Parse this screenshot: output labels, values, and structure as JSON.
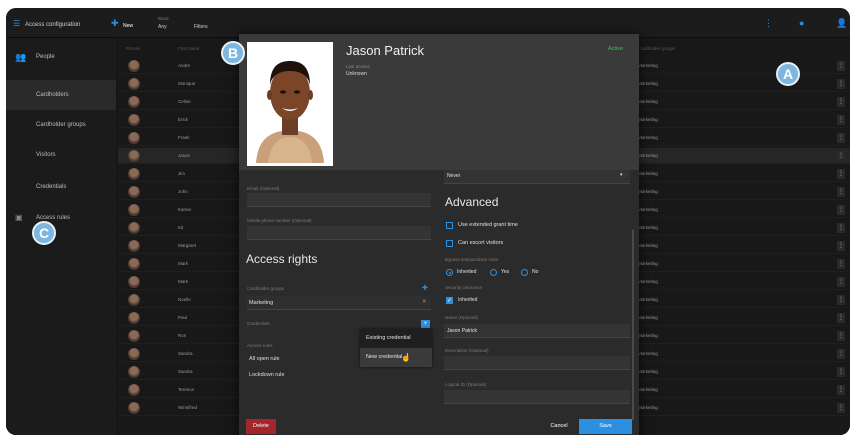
{
  "topbar": {
    "title": "Access configuration",
    "new_label": "New",
    "basic_label": "Basic",
    "any_label": "Any",
    "filters_label": "Filters"
  },
  "nav": {
    "section": "People",
    "items": [
      "Cardholders",
      "Cardholder groups",
      "Visitors",
      "Credentials"
    ],
    "access_rules": "Access rules"
  },
  "table": {
    "headers": [
      "Picture",
      "First name",
      "Cardholder groups"
    ],
    "rows": [
      {
        "first": "Andre",
        "group": "Marketing"
      },
      {
        "first": "Monique",
        "group": "Marketing"
      },
      {
        "first": "Celine",
        "group": "Marketing"
      },
      {
        "first": "Erick",
        "group": "Marketing"
      },
      {
        "first": "Frank",
        "group": "Marketing"
      },
      {
        "first": "Jason",
        "group": "Marketing"
      },
      {
        "first": "Jim",
        "group": "Marketing"
      },
      {
        "first": "John",
        "group": "Marketing"
      },
      {
        "first": "Karine",
        "group": "Marketing"
      },
      {
        "first": "Kit",
        "group": "Marketing"
      },
      {
        "first": "Margaret",
        "group": "Marketing"
      },
      {
        "first": "Mark",
        "group": "Marketing"
      },
      {
        "first": "Mark",
        "group": "Marketing"
      },
      {
        "first": "Noelle",
        "group": "Marketing"
      },
      {
        "first": "Paul",
        "group": "Marketing"
      },
      {
        "first": "Ron",
        "group": "Marketing"
      },
      {
        "first": "Sandra",
        "group": "Marketing"
      },
      {
        "first": "Sandra",
        "group": "Marketing"
      },
      {
        "first": "Terence",
        "group": "Marketing"
      },
      {
        "first": "Winnifred",
        "group": "Marketing"
      }
    ]
  },
  "modal": {
    "name": "Jason Patrick",
    "status": "Active",
    "last_access_label": "Last access",
    "last_access_value": "Unknown",
    "email_label": "Email (Optional)",
    "phone_label": "Mobile phone number (Optional)",
    "access_rights_heading": "Access rights",
    "cardholder_groups_label": "Cardholder groups",
    "cardholder_group_value": "Marketing",
    "credentials_label": "Credentials",
    "access_rules_label": "Access rules",
    "access_rules": [
      "All open rule",
      "Lockdown rule"
    ],
    "expiry_value": "Never",
    "advanced_heading": "Advanced",
    "extended_grant": "Use extended grant time",
    "escort": "Can escort visitors",
    "antipassback_label": "Bypass antipassback rules",
    "radio_inherited": "Inherited",
    "radio_yes": "Yes",
    "radio_no": "No",
    "security_label": "Security clearance",
    "security_inherited": "Inherited",
    "name_label": "Name (Optional)",
    "name_value": "Jason Patrick",
    "description_label": "Description (Optional)",
    "logical_id_label": "Logical ID (Optional)",
    "delete_label": "Delete",
    "cancel_label": "Cancel",
    "save_label": "Save"
  },
  "popup": {
    "items": [
      "Existing credential",
      "New credential"
    ]
  },
  "badges": {
    "a": "A",
    "b": "B",
    "c": "C"
  },
  "colors": {
    "accent": "#2d8fe0",
    "active": "#44c05a",
    "delete": "#a3262a",
    "badge": "#7fb6dd"
  }
}
